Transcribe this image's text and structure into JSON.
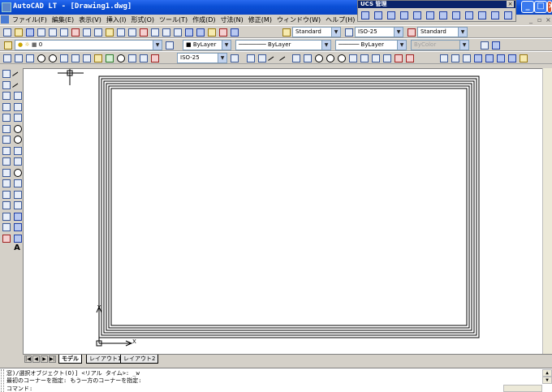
{
  "window": {
    "title": "AutoCAD LT - [Drawing1.dwg]",
    "controls": [
      "_",
      "□",
      "×"
    ]
  },
  "ucs_toolbar": {
    "title": "UCS 管理",
    "close": "×"
  },
  "menubar": {
    "items": [
      "ファイル(F)",
      "編集(E)",
      "表示(V)",
      "挿入(I)",
      "形式(O)",
      "ツール(T)",
      "作成(D)",
      "寸法(N)",
      "修正(M)",
      "ウィンドウ(W)",
      "ヘルプ(H)"
    ],
    "doc_controls": [
      "_",
      "▫",
      "×"
    ]
  },
  "toolbar_standard": {
    "text_style": "Standard",
    "dim_style": "ISO-25",
    "table_style": "Standard"
  },
  "toolbar_layers": {
    "layer_name": "0",
    "color": "ByLayer",
    "linetype": "ByLayer",
    "lineweight": "ByLayer",
    "plot_style": "ByColor"
  },
  "toolbar_dimension": {
    "dim_style": "ISO-25"
  },
  "draw_toolbar": {
    "text_tool": "A"
  },
  "ucs_icon": {
    "x_label": "X",
    "y_label": "Y"
  },
  "layout_tabs": {
    "tabs": [
      "モデル",
      "レイアウト1",
      "レイアウト2"
    ],
    "active": "モデル",
    "nav": [
      "|◀",
      "◀",
      "▶",
      "▶|"
    ]
  },
  "command_line": {
    "lines": [
      "窓)/選択オブジェクト(O)] <リアル タイム>: _w",
      "最初のコーナーを指定: もう一方のコーナーを指定:",
      "コマンド:"
    ]
  }
}
